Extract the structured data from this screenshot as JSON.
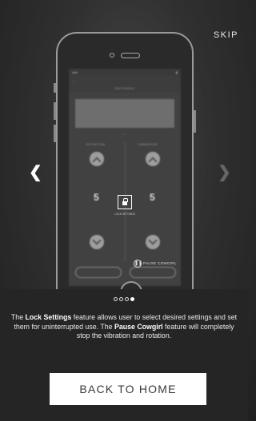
{
  "header": {
    "skip_label": "SKIP"
  },
  "carousel": {
    "prev_icon": "chevron-left-icon",
    "next_icon": "chevron-right-icon",
    "page_count": 4,
    "active_index": 3
  },
  "phone_screen": {
    "nav_title": "PATTERNS",
    "left_column_label": "ROTATION",
    "right_column_label": "VIBRATION",
    "rotation_value": "5",
    "vibration_value": "5",
    "lock_label": "LOCK SETTINGS",
    "pause_label": "PAUSE COWGIRL"
  },
  "description": {
    "part1": "The ",
    "bold1": "Lock Settings",
    "part2": " feature allows user to select desired settings and set them for uninterrupted use. The ",
    "bold2": "Pause Cowgirl",
    "part3": " feature will completely stop the vibration and rotation."
  },
  "footer": {
    "back_button_label": "BACK TO HOME"
  }
}
